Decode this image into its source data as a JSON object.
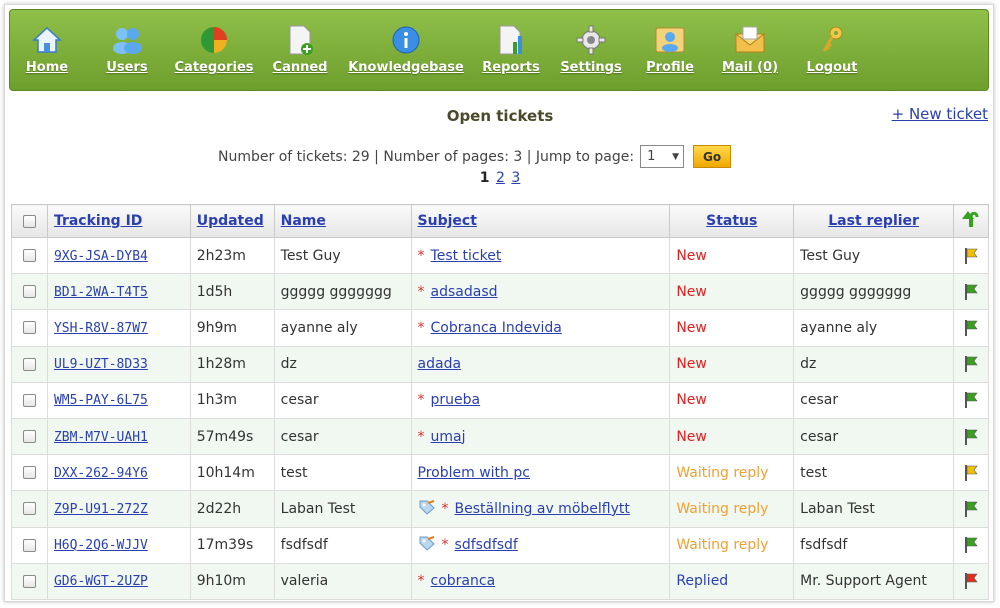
{
  "nav": [
    {
      "label": "Home",
      "icon": "home-icon"
    },
    {
      "label": "Users",
      "icon": "users-icon"
    },
    {
      "label": "Categories",
      "icon": "pie-chart-icon"
    },
    {
      "label": "Canned",
      "icon": "document-add-icon"
    },
    {
      "label": "Knowledgebase",
      "icon": "info-icon"
    },
    {
      "label": "Reports",
      "icon": "report-icon"
    },
    {
      "label": "Settings",
      "icon": "gear-icon"
    },
    {
      "label": "Profile",
      "icon": "profile-icon"
    },
    {
      "label": "Mail (0)",
      "icon": "mail-icon"
    },
    {
      "label": "Logout",
      "icon": "key-icon"
    }
  ],
  "page": {
    "title": "Open tickets",
    "new_ticket": "+ New ticket",
    "pager_text": "Number of tickets: 29 | Number of pages: 3 | Jump to page:",
    "jump_value": "1",
    "go_label": "Go",
    "pages": [
      "1",
      "2",
      "3"
    ],
    "current_page": "1"
  },
  "table": {
    "headers": {
      "tracking": "Tracking ID",
      "updated": "Updated",
      "name": "Name",
      "subject": "Subject",
      "status": "Status",
      "last_replier": "Last replier"
    },
    "rows": [
      {
        "id": "9XG-JSA-DYB4",
        "updated": "2h23m",
        "name": "Test Guy",
        "star": true,
        "tag": false,
        "subject": "Test ticket",
        "status": "New",
        "status_kind": "new",
        "replier": "Test Guy",
        "flag": "yellow"
      },
      {
        "id": "BD1-2WA-T4T5",
        "updated": "1d5h",
        "name": "ggggg ggggggg",
        "star": true,
        "tag": false,
        "subject": "adsadasd",
        "status": "New",
        "status_kind": "new",
        "replier": "ggggg ggggggg",
        "flag": "green"
      },
      {
        "id": "YSH-R8V-87W7",
        "updated": "9h9m",
        "name": "ayanne aly",
        "star": true,
        "tag": false,
        "subject": "Cobranca Indevida",
        "status": "New",
        "status_kind": "new",
        "replier": "ayanne aly",
        "flag": "green"
      },
      {
        "id": "UL9-UZT-8D33",
        "updated": "1h28m",
        "name": "dz",
        "star": false,
        "tag": false,
        "subject": "adada",
        "status": "New",
        "status_kind": "new",
        "replier": "dz",
        "flag": "green"
      },
      {
        "id": "WM5-PAY-6L75",
        "updated": "1h3m",
        "name": "cesar",
        "star": true,
        "tag": false,
        "subject": "prueba",
        "status": "New",
        "status_kind": "new",
        "replier": "cesar",
        "flag": "green"
      },
      {
        "id": "ZBM-M7V-UAH1",
        "updated": "57m49s",
        "name": "cesar",
        "star": true,
        "tag": false,
        "subject": "umaj",
        "status": "New",
        "status_kind": "new",
        "replier": "cesar",
        "flag": "green"
      },
      {
        "id": "DXX-262-94Y6",
        "updated": "10h14m",
        "name": "test",
        "star": false,
        "tag": false,
        "subject": "Problem with pc",
        "status": "Waiting reply",
        "status_kind": "wait",
        "replier": "test",
        "flag": "yellow"
      },
      {
        "id": "Z9P-U91-272Z",
        "updated": "2d22h",
        "name": "Laban Test",
        "star": true,
        "tag": true,
        "subject": "Beställning av möbelflytt",
        "status": "Waiting reply",
        "status_kind": "wait",
        "replier": "Laban Test",
        "flag": "green"
      },
      {
        "id": "H6Q-2Q6-WJJV",
        "updated": "17m39s",
        "name": "fsdfsdf",
        "star": true,
        "tag": true,
        "subject": "sdfsdfsdf",
        "status": "Waiting reply",
        "status_kind": "wait",
        "replier": "fsdfsdf",
        "flag": "green"
      },
      {
        "id": "GD6-WGT-2UZP",
        "updated": "9h10m",
        "name": "valeria",
        "star": true,
        "tag": false,
        "subject": "cobranca",
        "status": "Replied",
        "status_kind": "rep",
        "replier": "Mr. Support Agent",
        "flag": "red"
      }
    ]
  },
  "colors": {
    "nav_green": "#7aa83a",
    "link_blue": "#2a3fb0",
    "status_new": "#e02020",
    "status_wait": "#f0a030",
    "status_replied": "#2a3fb0",
    "flag_green": "#3aa020",
    "flag_yellow": "#f0c000",
    "flag_red": "#e03020"
  }
}
